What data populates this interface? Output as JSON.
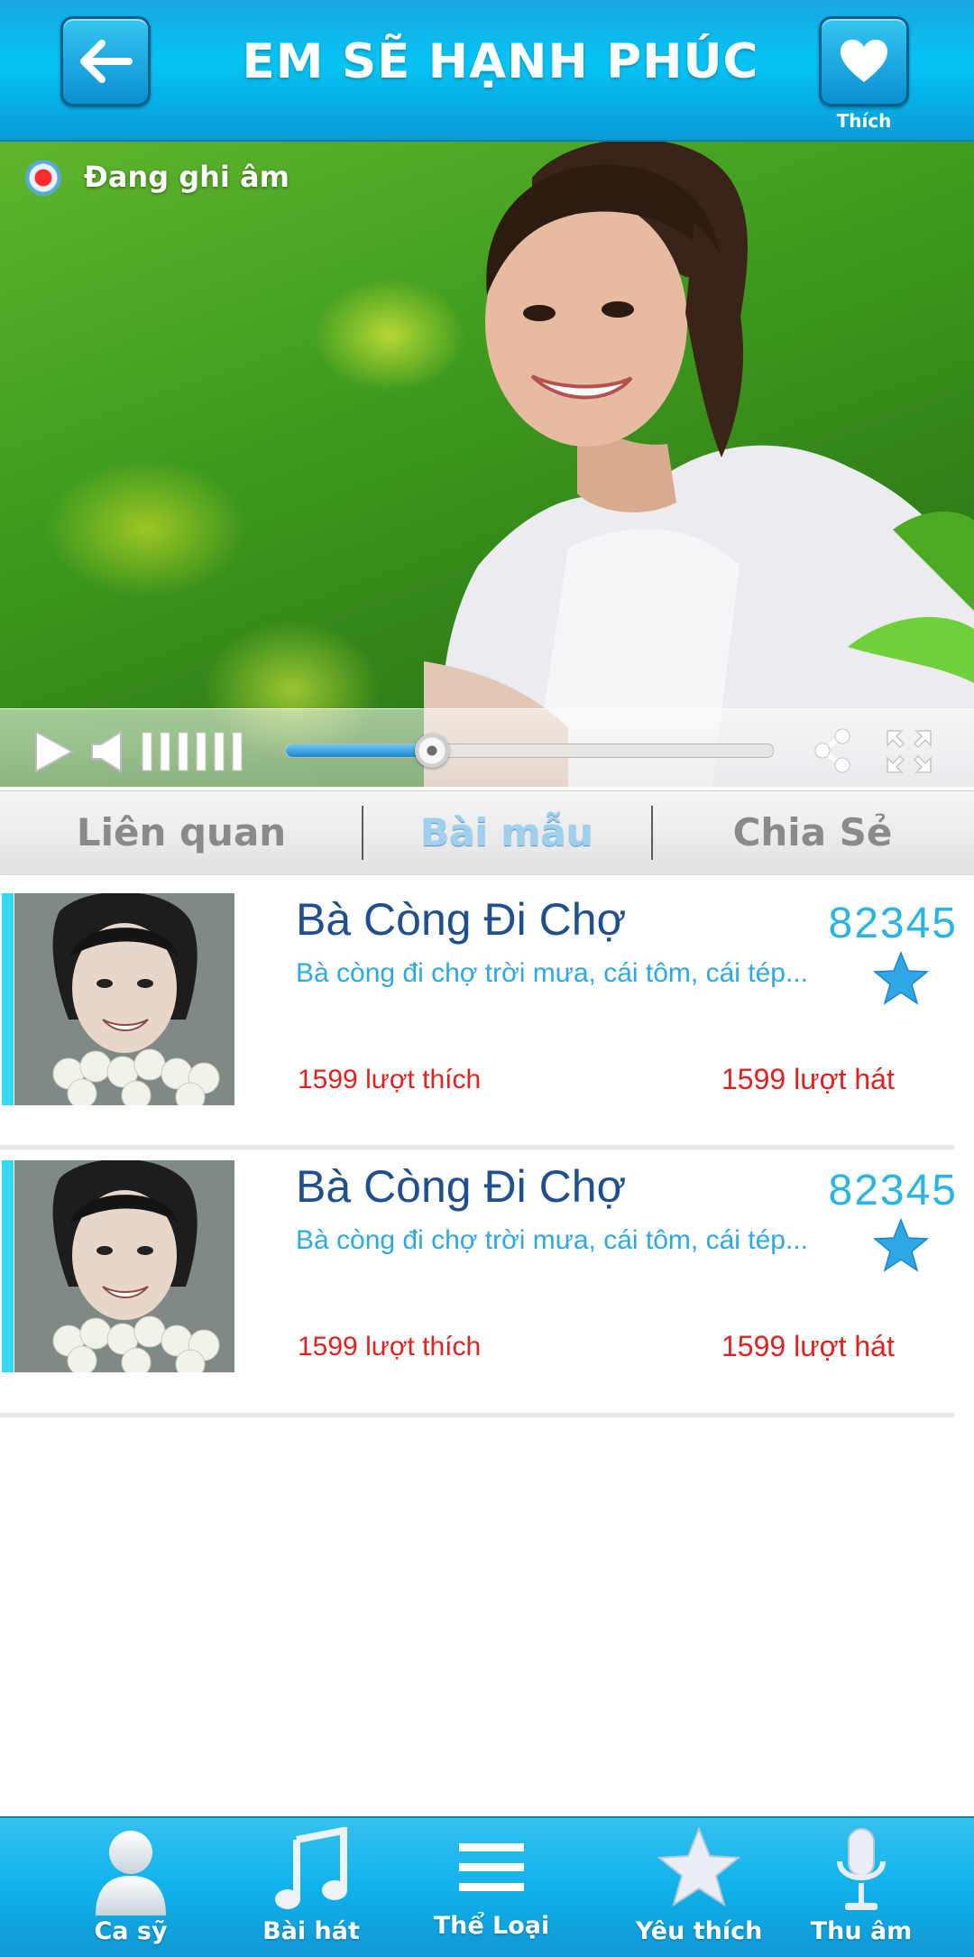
{
  "header": {
    "title": "EM SẼ HẠNH PHÚC",
    "back_icon": "arrow-left-icon",
    "like_icon": "heart-icon",
    "like_label": "Thích",
    "colors": {
      "bar": "#05c4f4",
      "button": "#0b8fd0"
    }
  },
  "video": {
    "recording_label": "Đang ghi âm",
    "progress": 0.3
  },
  "tabs": [
    {
      "label": "Liên quan"
    },
    {
      "label": "Bài mẫu",
      "active": true
    },
    {
      "label": "Chia Sẻ"
    }
  ],
  "songs": [
    {
      "title": "Bà Còng Đi Chợ",
      "code": "82345",
      "lyric": "Bà còng đi chợ trời mưa, cái tôm, cái tép...",
      "likes": "1599 lượt thích",
      "sings": "1599 lượt hát"
    },
    {
      "title": "Bà Còng Đi Chợ",
      "code": "82345",
      "lyric": "Bà còng đi chợ trời mưa, cái tôm, cái tép...",
      "likes": "1599 lượt thích",
      "sings": "1599 lượt hát"
    }
  ],
  "bottom_nav": [
    {
      "label": "Ca sỹ",
      "icon": "singer-icon"
    },
    {
      "label": "Bài hát",
      "icon": "music-note-icon"
    },
    {
      "label": "Thể Loại",
      "icon": "menu-lines-icon"
    },
    {
      "label": "Yêu thích",
      "icon": "star-icon"
    },
    {
      "label": "Thu âm",
      "icon": "microphone-icon"
    }
  ],
  "colors": {
    "accent": "#33d8f2",
    "song_title": "#1f4f8c",
    "song_code": "#29b3e6",
    "count_red": "#e0211f"
  }
}
